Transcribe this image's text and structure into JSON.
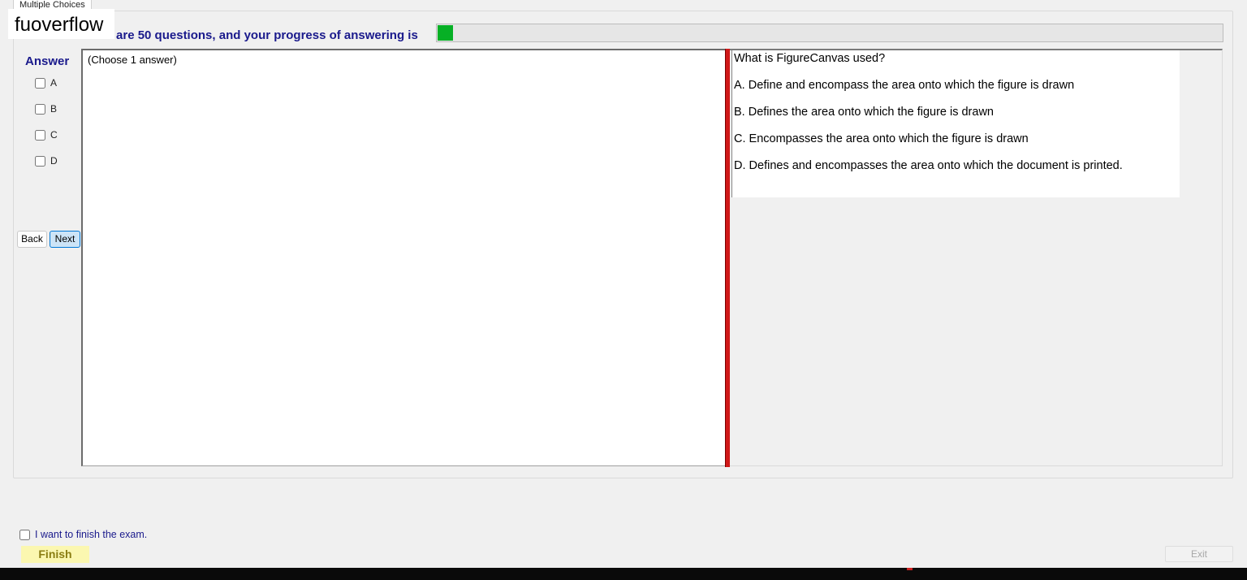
{
  "tab": {
    "label": "Multiple Choices"
  },
  "watermark": "fuoverflow",
  "progress": {
    "text": "There are 50 questions, and your progress of answering is",
    "fraction": 0.02
  },
  "answer_panel": {
    "title": "Answer",
    "options": [
      "A",
      "B",
      "C",
      "D"
    ],
    "hint": "(Choose 1 answer)"
  },
  "nav": {
    "back_label": "Back",
    "next_label": "Next"
  },
  "question": {
    "text": "What is FigureCanvas used?",
    "choices": [
      "A.  Define and encompass the area onto which the figure is drawn",
      "B.  Defines the area onto which the figure is drawn",
      "C.  Encompasses the area onto which the figure is drawn",
      "D.  Defines and encompasses the area onto which the document is printed."
    ]
  },
  "footer": {
    "finish_check_label": "I want to finish the exam.",
    "finish_label": "Finish",
    "exit_label": "Exit"
  },
  "colors": {
    "accent": "#1a1a8c",
    "progress": "#06b025",
    "splitter": "#d01818",
    "finish_bg": "#fbf7b0"
  }
}
